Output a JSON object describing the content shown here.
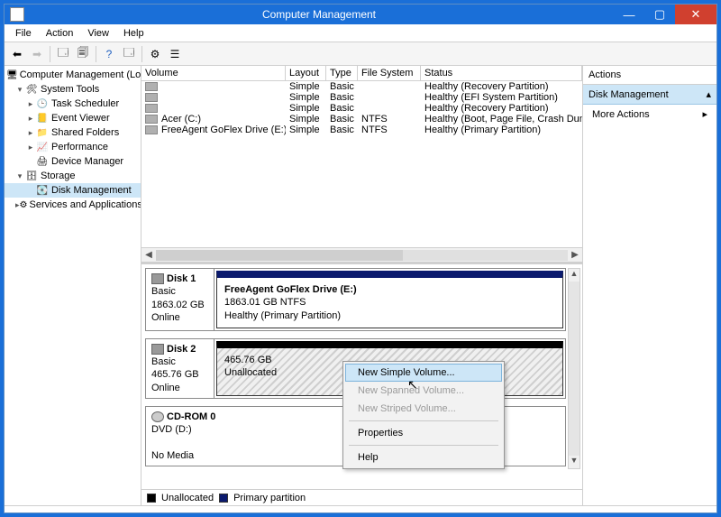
{
  "window": {
    "title": "Computer Management"
  },
  "menu": {
    "file": "File",
    "action": "Action",
    "view": "View",
    "help": "Help"
  },
  "tree": {
    "root": "Computer Management (Local)",
    "system_tools": "System Tools",
    "task_scheduler": "Task Scheduler",
    "event_viewer": "Event Viewer",
    "shared_folders": "Shared Folders",
    "performance": "Performance",
    "device_manager": "Device Manager",
    "storage": "Storage",
    "disk_management": "Disk Management",
    "services": "Services and Applications"
  },
  "volumes": {
    "columns": {
      "volume": "Volume",
      "layout": "Layout",
      "type": "Type",
      "fs": "File System",
      "status": "Status"
    },
    "rows": [
      {
        "name": "",
        "layout": "Simple",
        "type": "Basic",
        "fs": "",
        "status": "Healthy (Recovery Partition)"
      },
      {
        "name": "",
        "layout": "Simple",
        "type": "Basic",
        "fs": "",
        "status": "Healthy (EFI System Partition)"
      },
      {
        "name": "",
        "layout": "Simple",
        "type": "Basic",
        "fs": "",
        "status": "Healthy (Recovery Partition)"
      },
      {
        "name": "Acer (C:)",
        "layout": "Simple",
        "type": "Basic",
        "fs": "NTFS",
        "status": "Healthy (Boot, Page File, Crash Dump, Primary Par"
      },
      {
        "name": "FreeAgent GoFlex Drive (E:)",
        "layout": "Simple",
        "type": "Basic",
        "fs": "NTFS",
        "status": "Healthy (Primary Partition)"
      }
    ]
  },
  "disks": {
    "disk1": {
      "label": "Disk 1",
      "type": "Basic",
      "size": "1863.02 GB",
      "state": "Online",
      "vol_name": "FreeAgent GoFlex Drive  (E:)",
      "vol_size": "1863.01 GB NTFS",
      "vol_status": "Healthy (Primary Partition)"
    },
    "disk2": {
      "label": "Disk 2",
      "type": "Basic",
      "size": "465.76 GB",
      "state": "Online",
      "vol_size": "465.76 GB",
      "vol_status": "Unallocated"
    },
    "cdrom": {
      "label": "CD-ROM 0",
      "type": "DVD (D:)",
      "state": "No Media"
    }
  },
  "legend": {
    "unallocated": "Unallocated",
    "primary": "Primary partition"
  },
  "actions": {
    "header": "Actions",
    "disk_mgmt": "Disk Management",
    "more": "More Actions"
  },
  "context_menu": {
    "new_simple": "New Simple Volume...",
    "new_spanned": "New Spanned Volume...",
    "new_striped": "New Striped Volume...",
    "properties": "Properties",
    "help": "Help"
  }
}
